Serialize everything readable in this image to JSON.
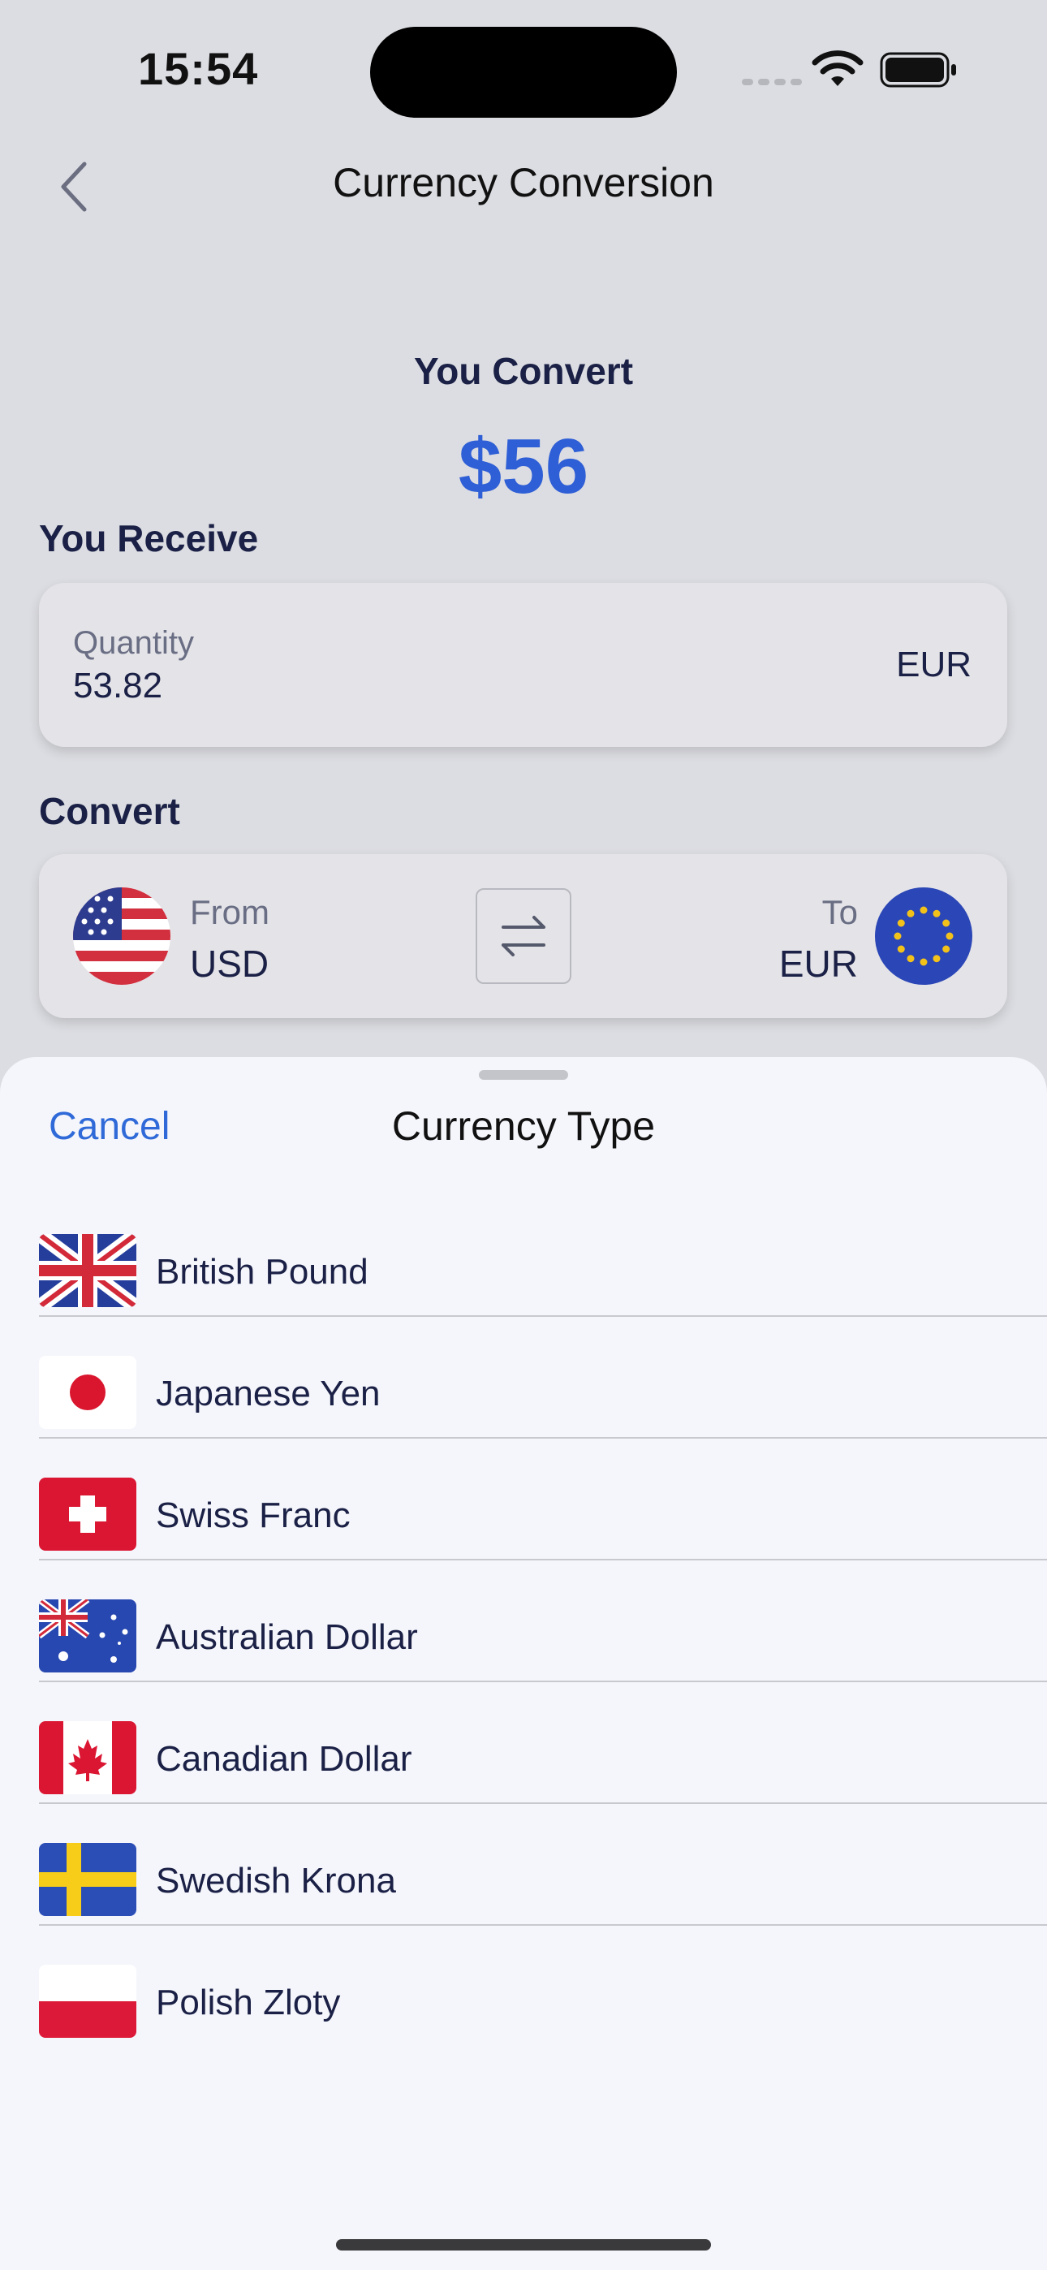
{
  "status_bar": {
    "time": "15:54"
  },
  "nav": {
    "title": "Currency Conversion"
  },
  "conversion": {
    "you_convert_label": "You Convert",
    "amount": "$56",
    "you_receive_label": "You Receive",
    "quantity_label": "Quantity",
    "quantity_value": "53.82",
    "quantity_currency": "EUR",
    "convert_label": "Convert",
    "from_label": "From",
    "from_code": "USD",
    "to_label": "To",
    "to_code": "EUR"
  },
  "sheet": {
    "cancel_label": "Cancel",
    "title": "Currency Type",
    "currencies": [
      {
        "name": "British Pound",
        "flag": "gb-flag-icon"
      },
      {
        "name": "Japanese Yen",
        "flag": "jp-flag-icon"
      },
      {
        "name": "Swiss Franc",
        "flag": "ch-flag-icon"
      },
      {
        "name": "Australian Dollar",
        "flag": "au-flag-icon"
      },
      {
        "name": "Canadian Dollar",
        "flag": "ca-flag-icon"
      },
      {
        "name": "Swedish Krona",
        "flag": "se-flag-icon"
      },
      {
        "name": "Polish Zloty",
        "flag": "pl-flag-icon"
      }
    ]
  },
  "colors": {
    "accent": "#2f5fd6",
    "background": "#dcdde2",
    "sheet": "#f5f6fb",
    "text": "#1b2146"
  }
}
